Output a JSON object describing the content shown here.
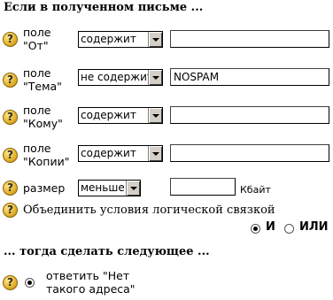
{
  "heading_if": "Если в полученном письме ...",
  "rows": [
    {
      "label": "поле\n\"От\"",
      "operator": "содержит",
      "value": ""
    },
    {
      "label": "поле\n\"Тема\"",
      "operator": "не содержит",
      "value": "NOSPAM"
    },
    {
      "label": "поле\n\"Кому\"",
      "operator": "содержит",
      "value": ""
    },
    {
      "label": "поле\n\"Копии\"",
      "operator": "содержит",
      "value": ""
    }
  ],
  "size_row": {
    "label": "размер",
    "operator": "меньше",
    "value": "",
    "unit": "Кбайт"
  },
  "combine_label": "Объединить условия логической связкой",
  "combine_options": [
    {
      "label": "И",
      "selected": true
    },
    {
      "label": "ИЛИ",
      "selected": false
    }
  ],
  "heading_then": "... тогда сделать следующее ...",
  "action": {
    "label": "ответить \"Нет\nтакого адреса\"",
    "selected": true
  },
  "help_icon_glyph": "?"
}
